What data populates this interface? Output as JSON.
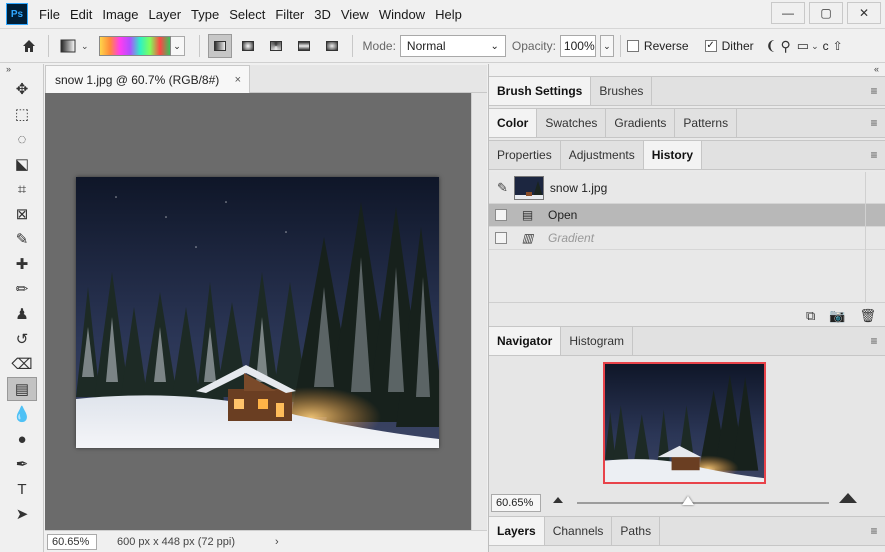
{
  "app": {
    "logo": "Ps",
    "menus": [
      "File",
      "Edit",
      "Image",
      "Layer",
      "Type",
      "Select",
      "Filter",
      "3D",
      "View",
      "Window",
      "Help"
    ],
    "window_controls": {
      "minimize": "—",
      "restore": "▢",
      "close": "✕"
    }
  },
  "options": {
    "mode_label": "Mode:",
    "mode_value": "Normal",
    "opacity_label": "Opacity:",
    "opacity_value": "100%",
    "reverse_label": "Reverse",
    "reverse_checked": false,
    "dither_label": "Dither",
    "dither_checked": true,
    "truncated_text": "c",
    "icons": [
      "home-icon",
      "gradient-preset-icon",
      "linear-gradient-icon",
      "radial-gradient-icon",
      "angle-gradient-icon",
      "reflected-gradient-icon",
      "diamond-gradient-icon"
    ]
  },
  "toolbar": {
    "collapse_glyph": "»",
    "tools": [
      {
        "name": "move-tool",
        "glyph": "✥"
      },
      {
        "name": "marquee-tool",
        "glyph": "⬚"
      },
      {
        "name": "lasso-tool",
        "glyph": "◌"
      },
      {
        "name": "object-select-tool",
        "glyph": "⬕"
      },
      {
        "name": "crop-tool",
        "glyph": "⌗"
      },
      {
        "name": "frame-tool",
        "glyph": "⊠"
      },
      {
        "name": "eyedropper-tool",
        "glyph": "✎"
      },
      {
        "name": "healing-brush-tool",
        "glyph": "✚"
      },
      {
        "name": "brush-tool",
        "glyph": "✏"
      },
      {
        "name": "clone-stamp-tool",
        "glyph": "♟"
      },
      {
        "name": "history-brush-tool",
        "glyph": "↺"
      },
      {
        "name": "eraser-tool",
        "glyph": "⌫"
      },
      {
        "name": "gradient-tool",
        "glyph": "▤",
        "active": true
      },
      {
        "name": "blur-tool",
        "glyph": "💧"
      },
      {
        "name": "dodge-tool",
        "glyph": "●"
      },
      {
        "name": "pen-tool",
        "glyph": "✒"
      },
      {
        "name": "type-tool",
        "glyph": "T"
      },
      {
        "name": "path-select-tool",
        "glyph": "➤"
      }
    ]
  },
  "document": {
    "tab_title": "snow 1.jpg @ 60.7% (RGB/8#)",
    "tab_close": "×",
    "status_zoom": "60.65%",
    "status_info": "600 px x 448 px (72 ppi)",
    "status_arrow": "›"
  },
  "panels": {
    "collapse_glyph": "«",
    "group1_tabs": [
      "Brush Settings",
      "Brushes"
    ],
    "group2_tabs": [
      "Color",
      "Swatches",
      "Gradients",
      "Patterns"
    ],
    "group3_tabs": [
      "Properties",
      "Adjustments",
      "History"
    ],
    "history": {
      "snapshot_name": "snow 1.jpg",
      "states": [
        {
          "label": "Open",
          "selected": true,
          "disabled": false
        },
        {
          "label": "Gradient",
          "selected": false,
          "disabled": true
        }
      ],
      "footer_icons": [
        "new-document-from-state-icon",
        "camera-icon",
        "trash-icon"
      ]
    },
    "group4_tabs": [
      "Navigator",
      "Histogram"
    ],
    "navigator": {
      "zoom_value": "60.65%",
      "slider_fraction": 0.44
    },
    "group5_tabs": [
      "Layers",
      "Channels",
      "Paths"
    ],
    "menu_glyph": "≡"
  },
  "colors": {
    "accent_red": "#e8434a",
    "canvas_bg": "#6b6b6b",
    "night_sky": "#1a2238"
  }
}
